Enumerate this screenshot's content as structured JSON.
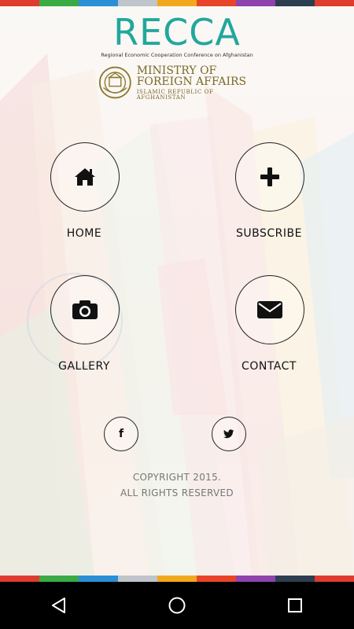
{
  "colors": {
    "stripe": [
      "#e03b2f",
      "#3aaa45",
      "#2a8fd6",
      "#bfc5ca",
      "#f2a81d",
      "#e8442a",
      "#8e44ad",
      "#2c3e50",
      "#e03b2f"
    ],
    "brand": "#22a79c",
    "ministry": "#7a6a2a"
  },
  "header": {
    "title": "RECCA",
    "subtitle": "Regional Economic Cooperation Conference on Afghanistan",
    "ministry_line1": "MINISTRY OF",
    "ministry_line2": "FOREIGN AFFAIRS",
    "ministry_line3": "ISLAMIC REPUBLIC OF AFGHANISTAN"
  },
  "menu": {
    "home": {
      "label": "HOME",
      "icon": "home-icon"
    },
    "subscribe": {
      "label": "SUBSCRIBE",
      "icon": "plus-icon"
    },
    "gallery": {
      "label": "GALLERY",
      "icon": "camera-icon"
    },
    "contact": {
      "label": "CONTACT",
      "icon": "envelope-icon"
    }
  },
  "social": {
    "facebook": {
      "icon": "facebook-icon",
      "glyph": "f"
    },
    "twitter": {
      "icon": "twitter-icon"
    }
  },
  "footer": {
    "copyright_line1": "COPYRIGHT 2015.",
    "copyright_line2": "ALL RIGHTS RESERVED"
  },
  "navbar": {
    "back": "back-icon",
    "home": "home-circle-icon",
    "recents": "recents-icon"
  }
}
